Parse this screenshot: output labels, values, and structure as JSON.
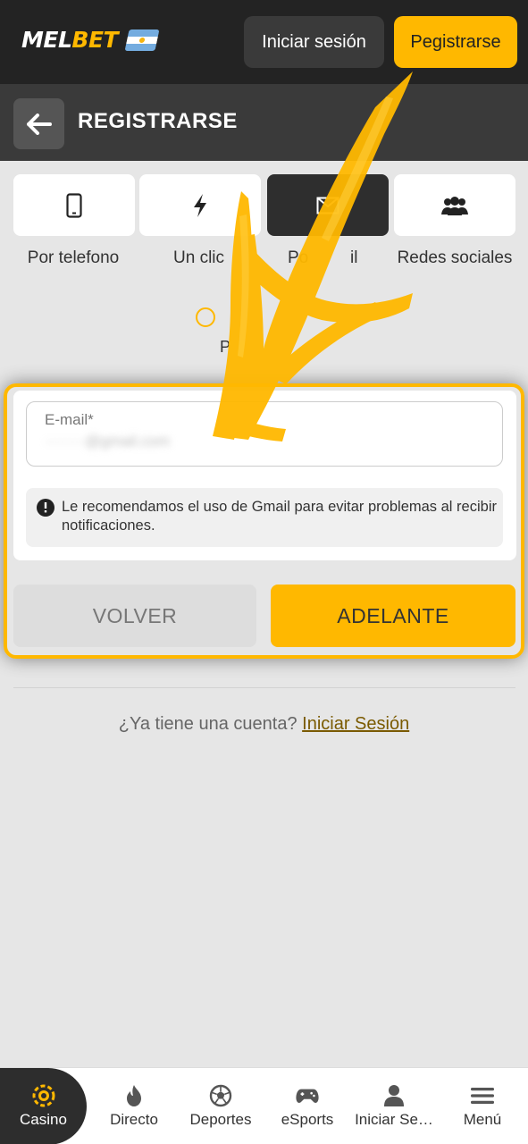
{
  "header": {
    "logo_prefix": "MEL",
    "logo_suffix": "BET",
    "login_label": "Iniciar sesión",
    "register_label": "Pegistrarse"
  },
  "title_bar": {
    "title": "REGISTRARSE"
  },
  "tabs": [
    {
      "label": "Por telefono",
      "icon": "phone-icon"
    },
    {
      "label": "Un clic",
      "icon": "lightning-icon"
    },
    {
      "label": "Por e-mail",
      "icon": "envelope-icon",
      "active": true
    },
    {
      "label": "Redes sociales",
      "icon": "people-icon"
    }
  ],
  "visible_tab_labels": {
    "tab1": "Por telefono",
    "tab2": "Un clic",
    "tab3": "Po",
    "tab3_end": "il",
    "tab4": "Redes sociales"
  },
  "steps": {
    "label_fragment": "P"
  },
  "form": {
    "email_label": "E-mail*",
    "email_value": "········@gmail.com",
    "notice": "Le recomendamos el uso de Gmail para evitar problemas al recibir notificaciones."
  },
  "actions": {
    "back_label": "VOLVER",
    "next_label": "ADELANTE"
  },
  "footer": {
    "question": "¿Ya tiene una cuenta?",
    "login_link": "Iniciar Sesión"
  },
  "bottom_nav": [
    {
      "label": "Casino",
      "icon": "casino-chip-icon",
      "active": true
    },
    {
      "label": "Directo",
      "icon": "fire-icon"
    },
    {
      "label": "Deportes",
      "icon": "soccer-ball-icon"
    },
    {
      "label": "eSports",
      "icon": "gamepad-icon"
    },
    {
      "label": "Iniciar Se…",
      "icon": "user-icon"
    },
    {
      "label": "Menú",
      "icon": "menu-icon"
    }
  ],
  "colors": {
    "accent": "#ffb800",
    "header_bg": "#232323",
    "titlebar_bg": "#3a3a3a",
    "page_bg": "#e6e6e6"
  }
}
